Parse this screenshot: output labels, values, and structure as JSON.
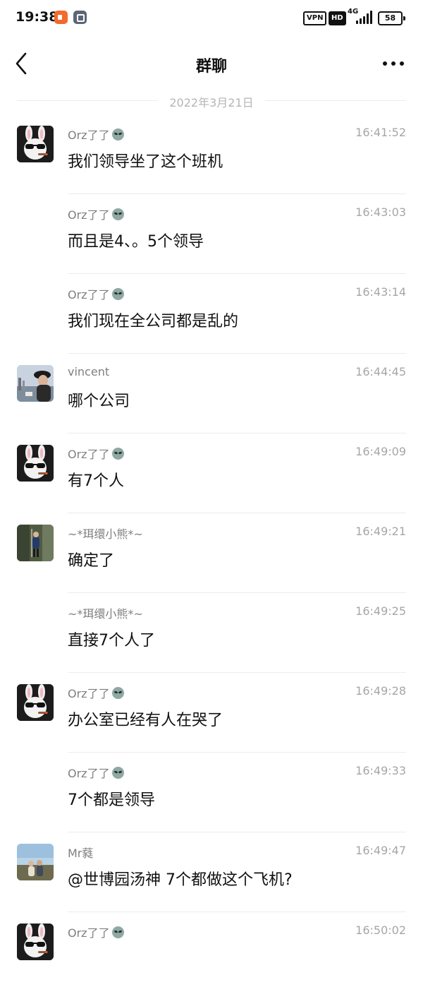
{
  "status_bar": {
    "time": "19:38",
    "vpn": "VPN",
    "hd": "HD",
    "network": "4G",
    "battery": "58"
  },
  "header": {
    "title": "群聊"
  },
  "date_divider": "2022年3月21日",
  "messages": [
    {
      "sender": "Orz了了",
      "time": "16:41:52",
      "text": "我们领导坐了这个班机",
      "avatar": "rabbit"
    },
    {
      "sender": "Orz了了",
      "time": "16:43:03",
      "text": "而且是4、。5个领导"
    },
    {
      "sender": "Orz了了",
      "time": "16:43:14",
      "text": "我们现在全公司都是乱的"
    },
    {
      "sender": "vincent",
      "time": "16:44:45",
      "text": "哪个公司",
      "avatar": "vincent"
    },
    {
      "sender": "Orz了了",
      "time": "16:49:09",
      "text": "有7个人",
      "avatar": "rabbit"
    },
    {
      "sender": "~*珥缳小熊*~",
      "time": "16:49:21",
      "text": "确定了",
      "avatar": "bear"
    },
    {
      "sender": "~*珥缳小熊*~",
      "time": "16:49:25",
      "text": "直接7个人了"
    },
    {
      "sender": "Orz了了",
      "time": "16:49:28",
      "text": "办公室已经有人在哭了",
      "avatar": "rabbit"
    },
    {
      "sender": "Orz了了",
      "time": "16:49:33",
      "text": "7个都是领导"
    },
    {
      "sender": "Mr蕤",
      "time": "16:49:47",
      "text": "@世博园汤神 7个都做这个飞机?",
      "avatar": "mr"
    },
    {
      "sender": "Orz了了",
      "time": "16:50:02",
      "text": "",
      "avatar": "rabbit"
    }
  ],
  "icons": {
    "back": "chevron-left-icon",
    "more": "more-dots-icon",
    "emoji": "alien-emoji-icon"
  }
}
